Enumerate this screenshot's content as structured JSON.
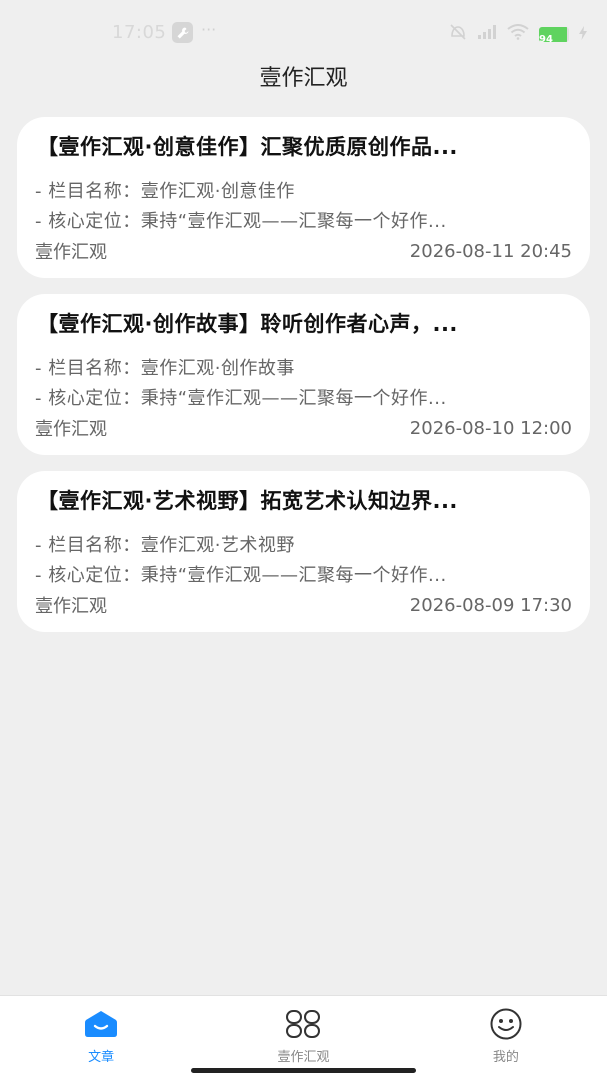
{
  "status": {
    "time": "17:05",
    "dots": "···",
    "battery": "94"
  },
  "header": {
    "title": "壹作汇观"
  },
  "articles": [
    {
      "title": "【壹作汇观·创意佳作】汇聚优质原创作品...",
      "line1": "- 栏目名称：壹作汇观·创意佳作",
      "line2": "- 核心定位：秉持“壹作汇观——汇聚每一个好作...",
      "source": "壹作汇观",
      "date": "2026-08-11 20:45"
    },
    {
      "title": "【壹作汇观·创作故事】聆听创作者心声，...",
      "line1": "- 栏目名称：壹作汇观·创作故事",
      "line2": "- 核心定位：秉持“壹作汇观——汇聚每一个好作...",
      "source": "壹作汇观",
      "date": "2026-08-10 12:00"
    },
    {
      "title": "【壹作汇观·艺术视野】拓宽艺术认知边界...",
      "line1": "- 栏目名称：壹作汇观·艺术视野",
      "line2": "- 核心定位：秉持“壹作汇观——汇聚每一个好作...",
      "source": "壹作汇观",
      "date": "2026-08-09 17:30"
    }
  ],
  "tabs": [
    {
      "label": "文章",
      "icon": "home-icon",
      "active": true
    },
    {
      "label": "壹作汇观",
      "icon": "grid-icon",
      "active": false
    },
    {
      "label": "我的",
      "icon": "smiley-icon",
      "active": false
    }
  ],
  "colors": {
    "accent": "#1a8cff",
    "background": "#efefef"
  }
}
